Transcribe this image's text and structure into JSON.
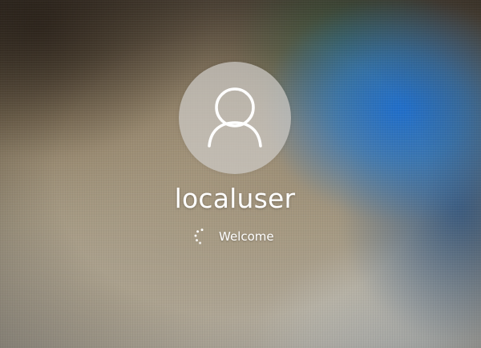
{
  "login": {
    "username": "localuser",
    "status_text": "Welcome",
    "avatar_icon": "user-icon",
    "spinner_icon": "loading-spinner-icon"
  },
  "colors": {
    "text": "#ffffff",
    "avatar_background": "#cdcbc6",
    "background_accent_blue": "#1e6ed2",
    "background_base": "#a59a84"
  }
}
